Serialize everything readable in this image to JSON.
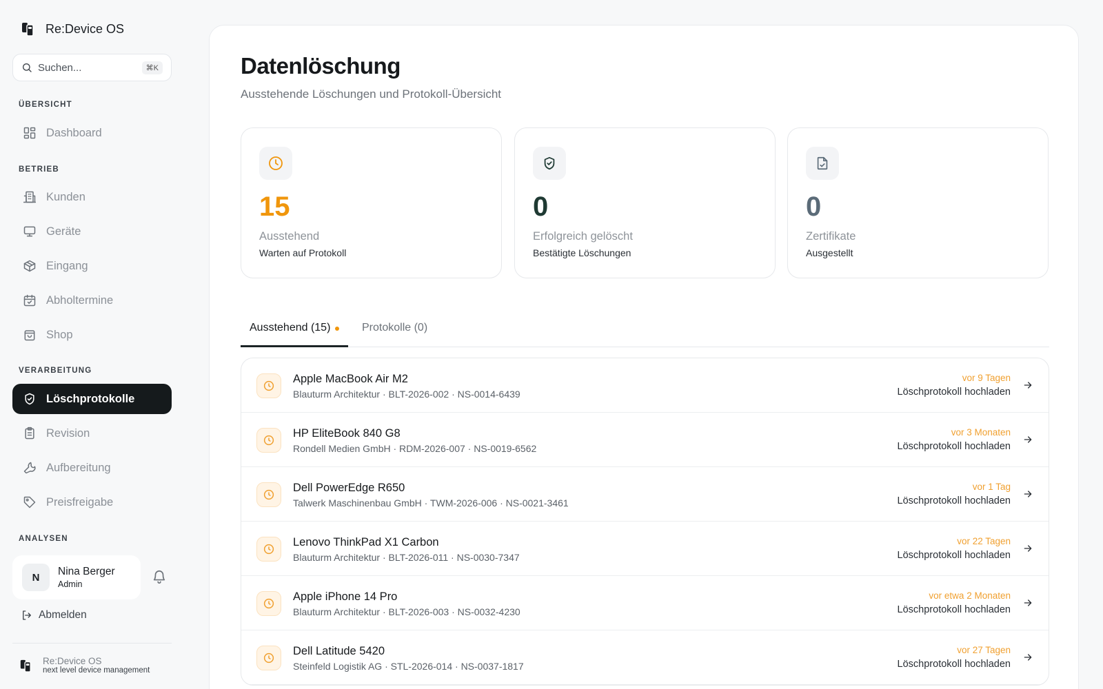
{
  "app": {
    "name": "Re:Device OS",
    "tagline": "next level device management"
  },
  "search": {
    "placeholder": "Suchen...",
    "shortcut": "⌘K"
  },
  "sidebar": {
    "sections": {
      "overview": "ÜBERSICHT",
      "operations": "BETRIEB",
      "processing": "VERARBEITUNG",
      "analytics": "ANALYSEN"
    },
    "items": {
      "dashboard": "Dashboard",
      "kunden": "Kunden",
      "geraete": "Geräte",
      "eingang": "Eingang",
      "abholtermine": "Abholtermine",
      "shop": "Shop",
      "loeschprotokolle": "Löschprotokolle",
      "revision": "Revision",
      "aufbereitung": "Aufbereitung",
      "preisfreigabe": "Preisfreigabe"
    }
  },
  "user": {
    "initial": "N",
    "name": "Nina Berger",
    "role": "Admin"
  },
  "logout_label": "Abmelden",
  "page": {
    "title": "Datenlöschung",
    "subtitle": "Ausstehende Löschungen und Protokoll-Übersicht"
  },
  "stats": {
    "pending": {
      "value": "15",
      "label": "Ausstehend",
      "sub": "Warten auf Protokoll",
      "color": "#f0960c"
    },
    "deleted": {
      "value": "0",
      "label": "Erfolgreich gelöscht",
      "sub": "Bestätigte Löschungen",
      "color": "#1f3a33"
    },
    "certificates": {
      "value": "0",
      "label": "Zertifikate",
      "sub": "Ausgestellt",
      "color": "#5b6b78"
    }
  },
  "tabs": {
    "pending": "Ausstehend (15)",
    "protocols": "Protokolle (0)"
  },
  "rows": [
    {
      "title": "Apple MacBook Air M2",
      "meta": "Blauturm Architektur · BLT-2026-002 · NS-0014-6439",
      "time": "vor 9 Tagen",
      "action": "Löschprotokoll hochladen"
    },
    {
      "title": "HP EliteBook 840 G8",
      "meta": "Rondell Medien GmbH · RDM-2026-007 · NS-0019-6562",
      "time": "vor 3 Monaten",
      "action": "Löschprotokoll hochladen"
    },
    {
      "title": "Dell PowerEdge R650",
      "meta": "Talwerk Maschinenbau GmbH · TWM-2026-006 · NS-0021-3461",
      "time": "vor 1 Tag",
      "action": "Löschprotokoll hochladen"
    },
    {
      "title": "Lenovo ThinkPad X1 Carbon",
      "meta": "Blauturm Architektur · BLT-2026-011 · NS-0030-7347",
      "time": "vor 22 Tagen",
      "action": "Löschprotokoll hochladen"
    },
    {
      "title": "Apple iPhone 14 Pro",
      "meta": "Blauturm Architektur · BLT-2026-003 · NS-0032-4230",
      "time": "vor etwa 2 Monaten",
      "action": "Löschprotokoll hochladen"
    },
    {
      "title": "Dell Latitude 5420",
      "meta": "Steinfeld Logistik AG · STL-2026-014 · NS-0037-1817",
      "time": "vor 27 Tagen",
      "action": "Löschprotokoll hochladen"
    }
  ]
}
